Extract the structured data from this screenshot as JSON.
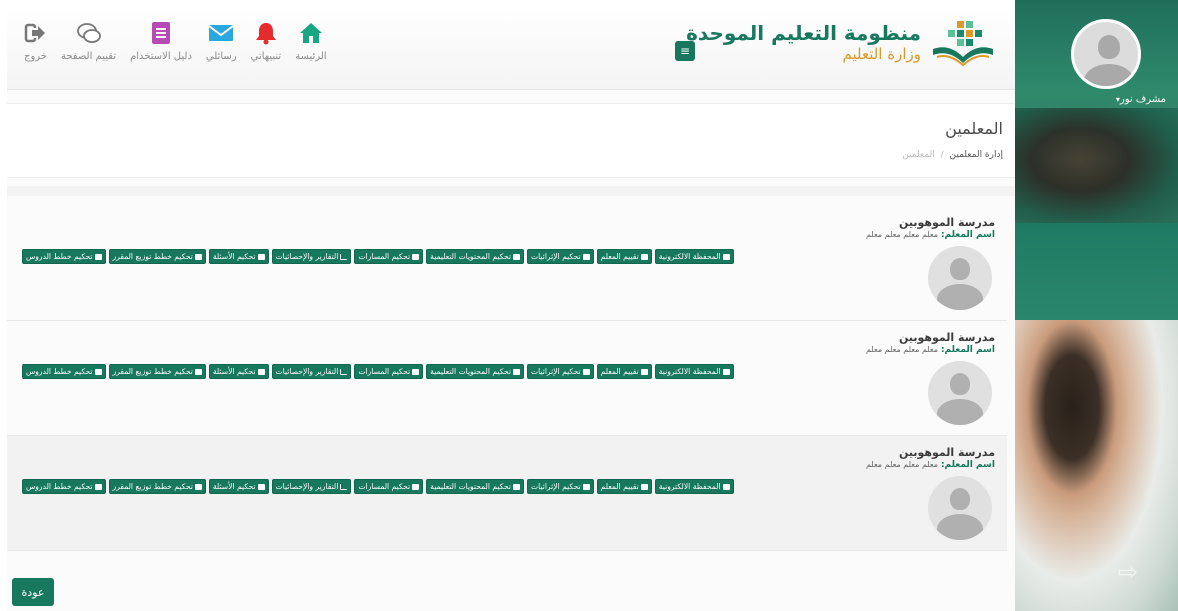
{
  "header": {
    "logo_title": "منظومة التعليم الموحدة",
    "logo_subtitle": "وزارة التعليم",
    "nav": [
      {
        "label": "خروج",
        "icon": "logout-icon"
      },
      {
        "label": "تقييم الصفحة",
        "icon": "feedback-icon"
      },
      {
        "label": "دليل الاستخدام",
        "icon": "guide-icon"
      },
      {
        "label": "رسائلي",
        "icon": "mail-icon"
      },
      {
        "label": "تنبيهاتي",
        "icon": "bell-icon"
      },
      {
        "label": "الرئيسة",
        "icon": "home-icon"
      }
    ]
  },
  "sidebar": {
    "user_name": "مشرف نور",
    "caret": "▾"
  },
  "page": {
    "title": "المعلمين",
    "breadcrumb": [
      "إدارة المعلمين",
      "المعلمين"
    ],
    "breadcrumb_sep": "/"
  },
  "teachers": [
    {
      "school": "مدرسة الموهوبين",
      "name_label": "اسم المعلم:",
      "name_value": "معلم معلم معلم معلم"
    },
    {
      "school": "مدرسة الموهوبين",
      "name_label": "اسم المعلم:",
      "name_value": "معلم معلم معلم معلم"
    },
    {
      "school": "مدرسة الموهوبين",
      "name_label": "اسم المعلم:",
      "name_value": "معلم معلم معلم معلم"
    }
  ],
  "actions": [
    {
      "label": "المحفظة الالكترونية",
      "icon": "monitor-icon"
    },
    {
      "label": "تقييم المعلم",
      "icon": "list-icon"
    },
    {
      "label": "تحكيم الإثرائيات",
      "icon": "list-icon"
    },
    {
      "label": "تحكيم المحتويات التعليمية",
      "icon": "monitor-icon"
    },
    {
      "label": "تحكيم المسارات",
      "icon": "monitor-icon"
    },
    {
      "label": "التقارير والإحصائيات",
      "icon": "chart-icon"
    },
    {
      "label": "تحكيم الأسئلة",
      "icon": "monitor-icon"
    },
    {
      "label": "تحكيم خطط توزيع المقرر",
      "icon": "monitor-icon"
    },
    {
      "label": "تحكيم خطط الدروس",
      "icon": "monitor-icon"
    }
  ],
  "footer": {
    "back_label": "عودة"
  },
  "colors": {
    "primary": "#17785e",
    "accent": "#d99a29"
  }
}
